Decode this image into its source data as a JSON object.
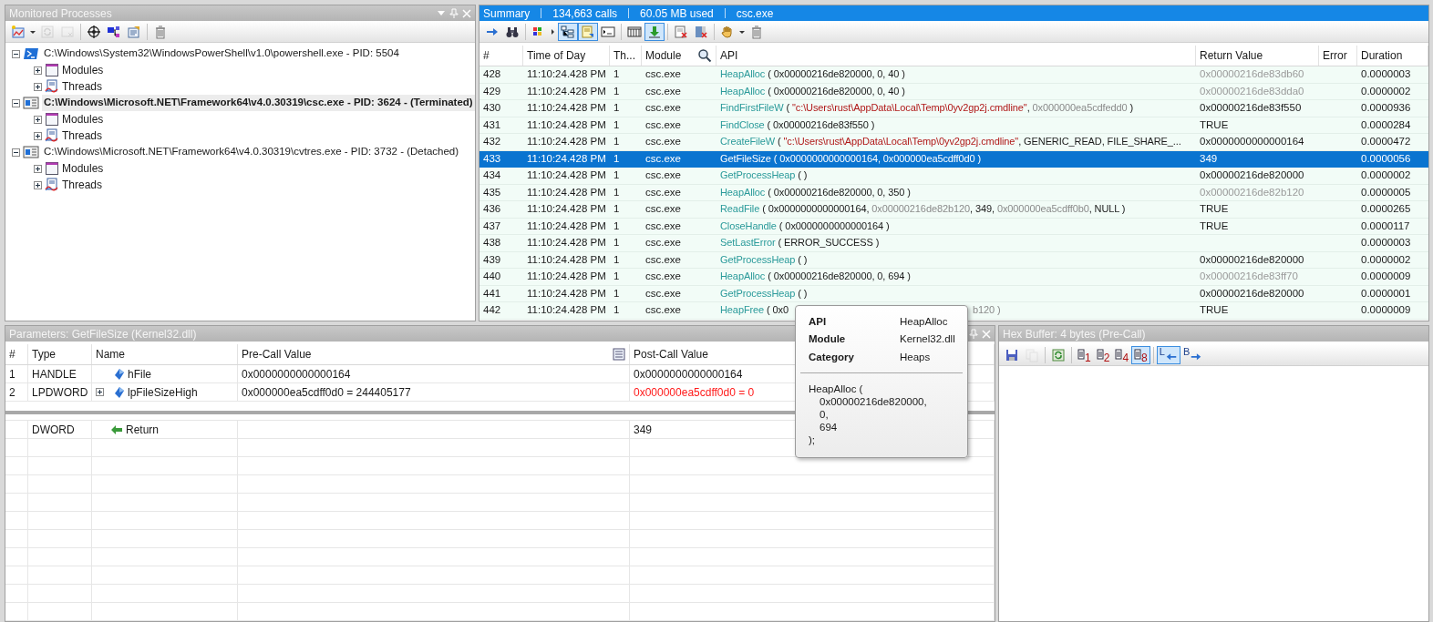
{
  "processes_panel": {
    "title": "Monitored Processes",
    "toolbar": [
      [
        {
          "kind": "new-monitor",
          "disabled": false
        },
        {
          "kind": "caret",
          "disabled": false
        },
        {
          "kind": "refresh",
          "disabled": true
        },
        {
          "kind": "close-window",
          "disabled": true
        }
      ],
      [
        {
          "kind": "crosshair",
          "disabled": false
        },
        {
          "kind": "diagram",
          "disabled": false
        },
        {
          "kind": "properties",
          "disabled": false
        }
      ],
      [
        {
          "kind": "trash",
          "disabled": false
        }
      ]
    ],
    "tree": [
      {
        "kind": "powershell",
        "label": "C:\\Windows\\System32\\WindowsPowerShell\\v1.0\\powershell.exe - PID: 5504",
        "expanded": true,
        "selected": false,
        "children": [
          {
            "kind": "modules",
            "label": "Modules",
            "expanded": false
          },
          {
            "kind": "threads",
            "label": "Threads",
            "expanded": false
          }
        ]
      },
      {
        "kind": "exe",
        "label": "C:\\Windows\\Microsoft.NET\\Framework64\\v4.0.30319\\csc.exe - PID: 3624 - (Terminated)",
        "expanded": true,
        "selected": true,
        "children": [
          {
            "kind": "modules",
            "label": "Modules",
            "expanded": false
          },
          {
            "kind": "threads",
            "label": "Threads",
            "expanded": false
          }
        ]
      },
      {
        "kind": "exe",
        "label": "C:\\Windows\\Microsoft.NET\\Framework64\\v4.0.30319\\cvtres.exe - PID: 3732 - (Detached)",
        "expanded": true,
        "selected": false,
        "children": [
          {
            "kind": "modules",
            "label": "Modules",
            "expanded": false
          },
          {
            "kind": "threads",
            "label": "Threads",
            "expanded": false
          }
        ]
      }
    ]
  },
  "summary_panel": {
    "title_parts": [
      "Summary",
      "134,663 calls",
      "60.05 MB used",
      "csc.exe"
    ],
    "toolbar": [
      [
        {
          "kind": "arrow",
          "selected": false
        },
        {
          "kind": "binoculars",
          "selected": false
        }
      ],
      [
        {
          "kind": "color-grid",
          "selected": false
        },
        {
          "kind": "caret-right",
          "selected": false
        },
        {
          "kind": "tree-view",
          "selected": true
        },
        {
          "kind": "note",
          "selected": true
        },
        {
          "kind": "console",
          "selected": false
        }
      ],
      [
        {
          "kind": "columns",
          "selected": false
        },
        {
          "kind": "download",
          "selected": true
        }
      ],
      [
        {
          "kind": "api-delete",
          "selected": false
        },
        {
          "kind": "delete",
          "selected": false
        }
      ],
      [
        {
          "kind": "hand",
          "selected": false
        },
        {
          "kind": "caret",
          "selected": false
        },
        {
          "kind": "trash",
          "selected": false
        }
      ]
    ],
    "columns": [
      "#",
      "Time of Day",
      "Th...",
      "Module",
      "API",
      "Return Value",
      "Error",
      "Duration"
    ],
    "rows": [
      {
        "num": "428",
        "time": "11:10:24.428 PM",
        "thread": "1",
        "module": "csc.exe",
        "api": [
          {
            "kind": "func",
            "text": "HeapAlloc"
          },
          {
            "kind": "text",
            "text": " ( 0x00000216de820000, 0, 40 )"
          }
        ],
        "ret": "0x00000216de83db60",
        "ret_dim": true,
        "duration": "0.0000003",
        "selected": false
      },
      {
        "num": "429",
        "time": "11:10:24.428 PM",
        "thread": "1",
        "module": "csc.exe",
        "api": [
          {
            "kind": "func",
            "text": "HeapAlloc"
          },
          {
            "kind": "text",
            "text": " ( 0x00000216de820000, 0, 40 )"
          }
        ],
        "ret": "0x00000216de83dda0",
        "ret_dim": true,
        "duration": "0.0000002",
        "selected": false
      },
      {
        "num": "430",
        "time": "11:10:24.428 PM",
        "thread": "1",
        "module": "csc.exe",
        "api": [
          {
            "kind": "func",
            "text": "FindFirstFileW"
          },
          {
            "kind": "text",
            "text": " ( "
          },
          {
            "kind": "string",
            "text": "\"c:\\Users\\rust\\AppData\\Local\\Temp\\0yv2gp2j.cmdline\""
          },
          {
            "kind": "text",
            "text": ", "
          },
          {
            "kind": "dim",
            "text": "0x000000ea5cdfedd0"
          },
          {
            "kind": "text",
            "text": " )"
          }
        ],
        "ret": "0x00000216de83f550",
        "ret_dim": false,
        "duration": "0.0000936",
        "selected": false
      },
      {
        "num": "431",
        "time": "11:10:24.428 PM",
        "thread": "1",
        "module": "csc.exe",
        "api": [
          {
            "kind": "func",
            "text": "FindClose"
          },
          {
            "kind": "text",
            "text": " ( 0x00000216de83f550 )"
          }
        ],
        "ret": "TRUE",
        "ret_dim": false,
        "duration": "0.0000284",
        "selected": false
      },
      {
        "num": "432",
        "time": "11:10:24.428 PM",
        "thread": "1",
        "module": "csc.exe",
        "api": [
          {
            "kind": "func",
            "text": "CreateFileW"
          },
          {
            "kind": "text",
            "text": " ( "
          },
          {
            "kind": "string",
            "text": "\"c:\\Users\\rust\\AppData\\Local\\Temp\\0yv2gp2j.cmdline\""
          },
          {
            "kind": "text",
            "text": ", GENERIC_READ, FILE_SHARE_..."
          }
        ],
        "ret": "0x0000000000000164",
        "ret_dim": false,
        "duration": "0.0000472",
        "selected": false
      },
      {
        "num": "433",
        "time": "11:10:24.428 PM",
        "thread": "1",
        "module": "csc.exe",
        "api": [
          {
            "kind": "func",
            "text": "GetFileSize"
          },
          {
            "kind": "text",
            "text": " ( 0x0000000000000164, 0x000000ea5cdff0d0 )"
          }
        ],
        "ret": "349",
        "ret_dim": false,
        "duration": "0.0000056",
        "selected": true
      },
      {
        "num": "434",
        "time": "11:10:24.428 PM",
        "thread": "1",
        "module": "csc.exe",
        "api": [
          {
            "kind": "func",
            "text": "GetProcessHeap"
          },
          {
            "kind": "text",
            "text": " ( )"
          }
        ],
        "ret": "0x00000216de820000",
        "ret_dim": false,
        "duration": "0.0000002",
        "selected": false
      },
      {
        "num": "435",
        "time": "11:10:24.428 PM",
        "thread": "1",
        "module": "csc.exe",
        "api": [
          {
            "kind": "func",
            "text": "HeapAlloc"
          },
          {
            "kind": "text",
            "text": " ( 0x00000216de820000, 0, 350 )"
          }
        ],
        "ret": "0x00000216de82b120",
        "ret_dim": true,
        "duration": "0.0000005",
        "selected": false
      },
      {
        "num": "436",
        "time": "11:10:24.428 PM",
        "thread": "1",
        "module": "csc.exe",
        "api": [
          {
            "kind": "func",
            "text": "ReadFile"
          },
          {
            "kind": "text",
            "text": " ( 0x0000000000000164, "
          },
          {
            "kind": "dim",
            "text": "0x00000216de82b120"
          },
          {
            "kind": "text",
            "text": ", 349, "
          },
          {
            "kind": "dim",
            "text": "0x000000ea5cdff0b0"
          },
          {
            "kind": "text",
            "text": ", NULL )"
          }
        ],
        "ret": "TRUE",
        "ret_dim": false,
        "duration": "0.0000265",
        "selected": false
      },
      {
        "num": "437",
        "time": "11:10:24.428 PM",
        "thread": "1",
        "module": "csc.exe",
        "api": [
          {
            "kind": "func",
            "text": "CloseHandle"
          },
          {
            "kind": "text",
            "text": " ( 0x0000000000000164 )"
          }
        ],
        "ret": "TRUE",
        "ret_dim": false,
        "duration": "0.0000117",
        "selected": false
      },
      {
        "num": "438",
        "time": "11:10:24.428 PM",
        "thread": "1",
        "module": "csc.exe",
        "api": [
          {
            "kind": "func",
            "text": "SetLastError"
          },
          {
            "kind": "text",
            "text": " ( ERROR_SUCCESS )"
          }
        ],
        "duration": "0.0000003",
        "selected": false
      },
      {
        "num": "439",
        "time": "11:10:24.428 PM",
        "thread": "1",
        "module": "csc.exe",
        "api": [
          {
            "kind": "func",
            "text": "GetProcessHeap"
          },
          {
            "kind": "text",
            "text": " ( )"
          }
        ],
        "ret": "0x00000216de820000",
        "ret_dim": false,
        "duration": "0.0000002",
        "selected": false
      },
      {
        "num": "440",
        "time": "11:10:24.428 PM",
        "thread": "1",
        "module": "csc.exe",
        "api": [
          {
            "kind": "func",
            "text": "HeapAlloc"
          },
          {
            "kind": "text",
            "text": " ( 0x00000216de820000, 0, 694 )"
          }
        ],
        "ret": "0x00000216de83ff70",
        "ret_dim": true,
        "duration": "0.0000009",
        "selected": false
      },
      {
        "num": "441",
        "time": "11:10:24.428 PM",
        "thread": "1",
        "module": "csc.exe",
        "api": [
          {
            "kind": "func",
            "text": "GetProcessHeap"
          },
          {
            "kind": "text",
            "text": " ( )"
          }
        ],
        "ret": "0x00000216de820000",
        "ret_dim": false,
        "duration": "0.0000001",
        "selected": false
      },
      {
        "num": "442",
        "time": "11:10:24.428 PM",
        "thread": "1",
        "module": "csc.exe",
        "api": [
          {
            "kind": "func",
            "text": "HeapFree"
          },
          {
            "kind": "text",
            "text": " ( 0x0"
          }
        ],
        "api_tail": "b120 )",
        "ret": "TRUE",
        "ret_dim": false,
        "duration": "0.0000009",
        "selected": false
      }
    ]
  },
  "parameters_panel": {
    "title": "Parameters: GetFileSize (Kernel32.dll)",
    "columns": [
      "#",
      "Type",
      "Name",
      "Pre-Call Value",
      "Post-Call Value"
    ],
    "rows": [
      {
        "num": "1",
        "type": "HANDLE",
        "name": "hFile",
        "expandable": false,
        "pre": "0x0000000000000164",
        "post": "0x0000000000000164",
        "changed": false
      },
      {
        "num": "2",
        "type": "LPDWORD",
        "name": "lpFileSizeHigh",
        "expandable": true,
        "pre": "0x000000ea5cdff0d0 = 244405177",
        "post": "0x000000ea5cdff0d0 = 0",
        "changed": true
      }
    ],
    "return_row": {
      "type": "DWORD",
      "name": "Return",
      "post": "349"
    }
  },
  "hex_panel": {
    "title": "Hex Buffer: 4 bytes (Pre-Call)",
    "toolbar": [
      [
        {
          "kind": "save",
          "selected": false,
          "disabled": false
        },
        {
          "kind": "copy",
          "selected": false,
          "disabled": true
        }
      ],
      [
        {
          "kind": "refresh",
          "selected": false,
          "disabled": false
        }
      ],
      [
        {
          "kind": "width",
          "label": "1",
          "selected": false,
          "disabled": false
        },
        {
          "kind": "width",
          "label": "2",
          "selected": false,
          "disabled": false
        },
        {
          "kind": "width",
          "label": "4",
          "selected": false,
          "disabled": false
        },
        {
          "kind": "width",
          "label": "8",
          "selected": true,
          "disabled": false
        }
      ],
      [
        {
          "kind": "endian-left",
          "label": "L",
          "selected": true,
          "disabled": false
        },
        {
          "kind": "endian-right",
          "label": "B",
          "selected": false,
          "disabled": false
        }
      ]
    ]
  },
  "tooltip": {
    "fields": [
      {
        "label": "API",
        "value": "HeapAlloc"
      },
      {
        "label": "Module",
        "value": "Kernel32.dll"
      },
      {
        "label": "Category",
        "value": "Heaps"
      }
    ],
    "call": "HeapAlloc (",
    "args": [
      "0x00000216de820000,",
      "0,",
      "694"
    ],
    "close": ");"
  }
}
